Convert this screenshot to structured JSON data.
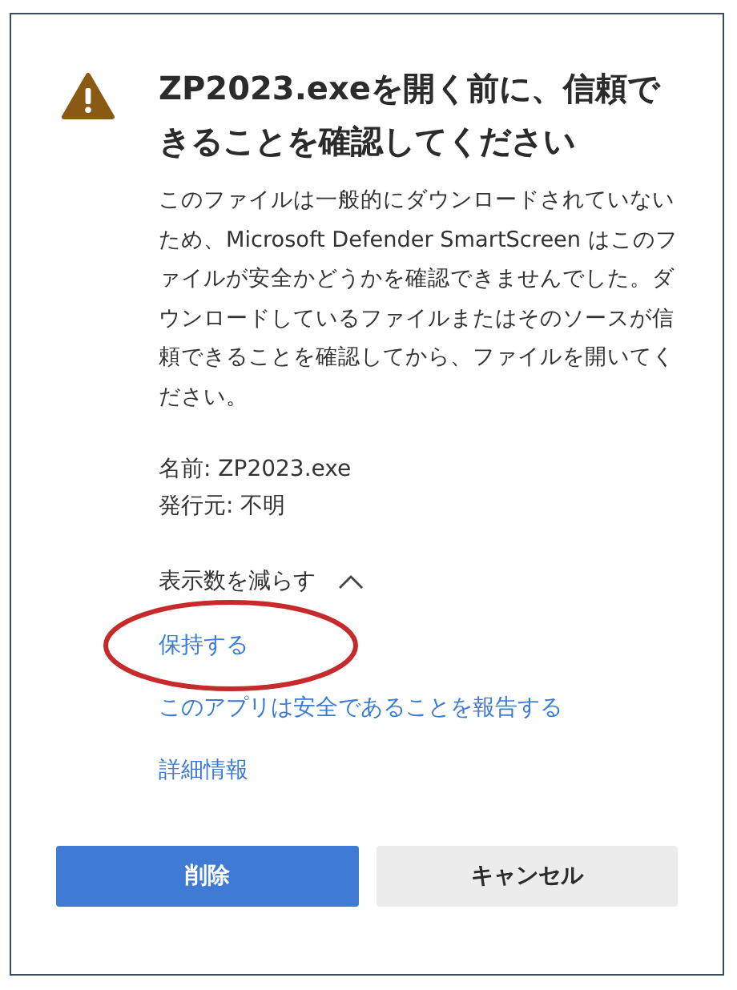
{
  "dialog": {
    "title": "ZP2023.exeを開く前に、信頼できることを確認してください",
    "message": "このファイルは一般的にダウンロードされていないため、Microsoft Defender SmartScreen はこのファイルが安全かどうかを確認できませんでした。ダウンロードしているファイルまたはそのソースが信頼できることを確認してから、ファイルを開いてください。",
    "details": [
      "名前: ZP2023.exe",
      "発行元: 不明"
    ],
    "toggle": {
      "label": "表示数を減らす",
      "expanded": true
    },
    "links": [
      {
        "label": "保持する",
        "highlighted": true
      },
      {
        "label": "このアプリは安全であることを報告する",
        "highlighted": false
      },
      {
        "label": "詳細情報",
        "highlighted": false
      }
    ],
    "buttons": [
      {
        "label": "削除",
        "kind": "primary"
      },
      {
        "label": "キャンセル",
        "kind": "secondary"
      }
    ]
  }
}
